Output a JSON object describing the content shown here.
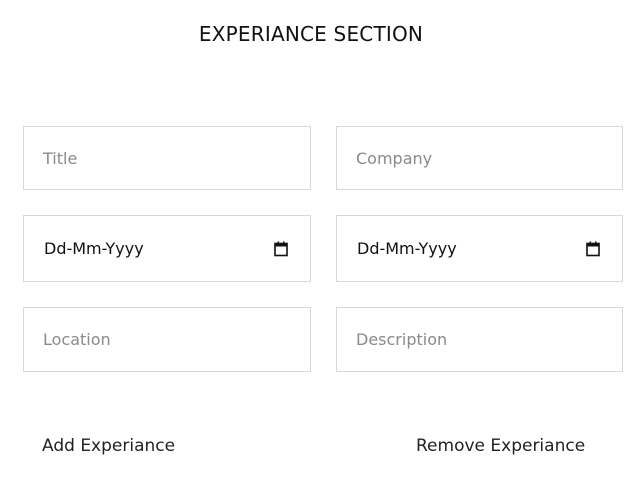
{
  "section": {
    "title": "EXPERIANCE SECTION"
  },
  "form": {
    "title_placeholder": "Title",
    "company_placeholder": "Company",
    "start_date_value": "Dd-Mm-Yyyy",
    "end_date_value": "Dd-Mm-Yyyy",
    "location_placeholder": "Location",
    "description_placeholder": "Description"
  },
  "icons": {
    "date_picker": "calendar-icon"
  },
  "actions": {
    "add_label": "Add Experiance",
    "remove_label": "Remove Experiance"
  }
}
